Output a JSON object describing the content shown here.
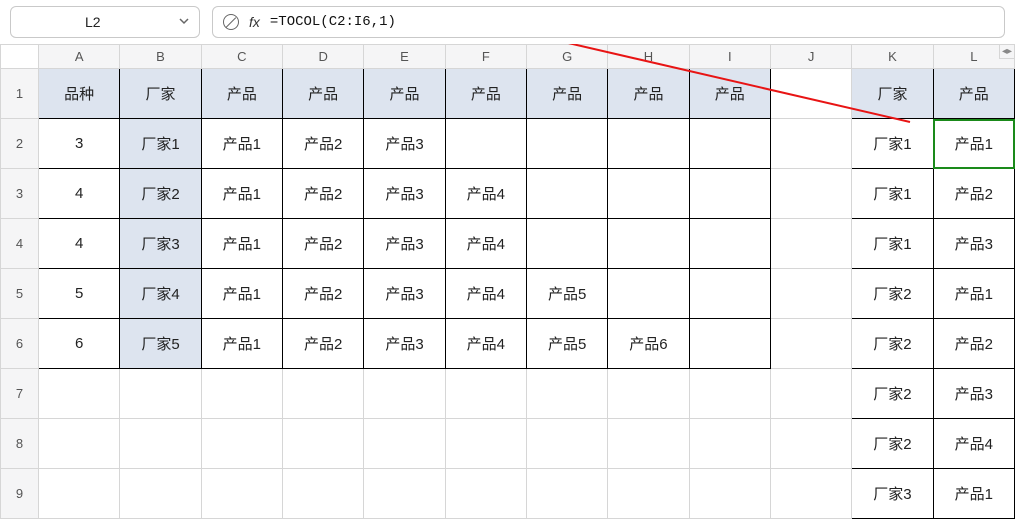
{
  "namebox": {
    "value": "L2"
  },
  "formula_bar": {
    "fx_label": "fx",
    "formula": "=TOCOL(C2:I6,1)"
  },
  "columns": [
    "A",
    "B",
    "C",
    "D",
    "E",
    "F",
    "G",
    "H",
    "I",
    "J",
    "K",
    "L"
  ],
  "row_numbers": [
    "1",
    "2",
    "3",
    "4",
    "5",
    "6",
    "7",
    "8",
    "9"
  ],
  "headers_row1": {
    "A": "品种",
    "B": "厂家",
    "C": "产品",
    "D": "产品",
    "E": "产品",
    "F": "产品",
    "G": "产品",
    "H": "产品",
    "I": "产品",
    "K": "厂家",
    "L": "产品"
  },
  "rows": [
    {
      "A": "3",
      "B": "厂家1",
      "C": "产品1",
      "D": "产品2",
      "E": "产品3",
      "F": "",
      "G": "",
      "H": "",
      "I": "",
      "K": "厂家1",
      "L": "产品1"
    },
    {
      "A": "4",
      "B": "厂家2",
      "C": "产品1",
      "D": "产品2",
      "E": "产品3",
      "F": "产品4",
      "G": "",
      "H": "",
      "I": "",
      "K": "厂家1",
      "L": "产品2"
    },
    {
      "A": "4",
      "B": "厂家3",
      "C": "产品1",
      "D": "产品2",
      "E": "产品3",
      "F": "产品4",
      "G": "",
      "H": "",
      "I": "",
      "K": "厂家1",
      "L": "产品3"
    },
    {
      "A": "5",
      "B": "厂家4",
      "C": "产品1",
      "D": "产品2",
      "E": "产品3",
      "F": "产品4",
      "G": "产品5",
      "H": "",
      "I": "",
      "K": "厂家2",
      "L": "产品1"
    },
    {
      "A": "6",
      "B": "厂家5",
      "C": "产品1",
      "D": "产品2",
      "E": "产品3",
      "F": "产品4",
      "G": "产品5",
      "H": "产品6",
      "I": "",
      "K": "厂家2",
      "L": "产品2"
    },
    {
      "A": "",
      "B": "",
      "C": "",
      "D": "",
      "E": "",
      "F": "",
      "G": "",
      "H": "",
      "I": "",
      "K": "厂家2",
      "L": "产品3"
    },
    {
      "A": "",
      "B": "",
      "C": "",
      "D": "",
      "E": "",
      "F": "",
      "G": "",
      "H": "",
      "I": "",
      "K": "厂家2",
      "L": "产品4"
    },
    {
      "A": "",
      "B": "",
      "C": "",
      "D": "",
      "E": "",
      "F": "",
      "G": "",
      "H": "",
      "I": "",
      "K": "厂家3",
      "L": "产品1"
    }
  ],
  "chart_data": {
    "type": "table",
    "title": "TOCOL formula demo",
    "source_range": "C2:I6",
    "formula": "=TOCOL(C2:I6,1)",
    "input_table": {
      "columns": [
        "品种",
        "厂家",
        "产品",
        "产品",
        "产品",
        "产品",
        "产品",
        "产品",
        "产品"
      ],
      "rows": [
        [
          "3",
          "厂家1",
          "产品1",
          "产品2",
          "产品3",
          "",
          "",
          "",
          ""
        ],
        [
          "4",
          "厂家2",
          "产品1",
          "产品2",
          "产品3",
          "产品4",
          "",
          "",
          ""
        ],
        [
          "4",
          "厂家3",
          "产品1",
          "产品2",
          "产品3",
          "产品4",
          "",
          "",
          ""
        ],
        [
          "5",
          "厂家4",
          "产品1",
          "产品2",
          "产品3",
          "产品4",
          "产品5",
          "",
          ""
        ],
        [
          "6",
          "厂家5",
          "产品1",
          "产品2",
          "产品3",
          "产品4",
          "产品5",
          "产品6",
          ""
        ]
      ]
    },
    "output_columns": {
      "K_header": "厂家",
      "L_header": "产品",
      "visible_pairs": [
        [
          "厂家1",
          "产品1"
        ],
        [
          "厂家1",
          "产品2"
        ],
        [
          "厂家1",
          "产品3"
        ],
        [
          "厂家2",
          "产品1"
        ],
        [
          "厂家2",
          "产品2"
        ],
        [
          "厂家2",
          "产品3"
        ],
        [
          "厂家2",
          "产品4"
        ],
        [
          "厂家3",
          "产品1"
        ]
      ]
    }
  }
}
